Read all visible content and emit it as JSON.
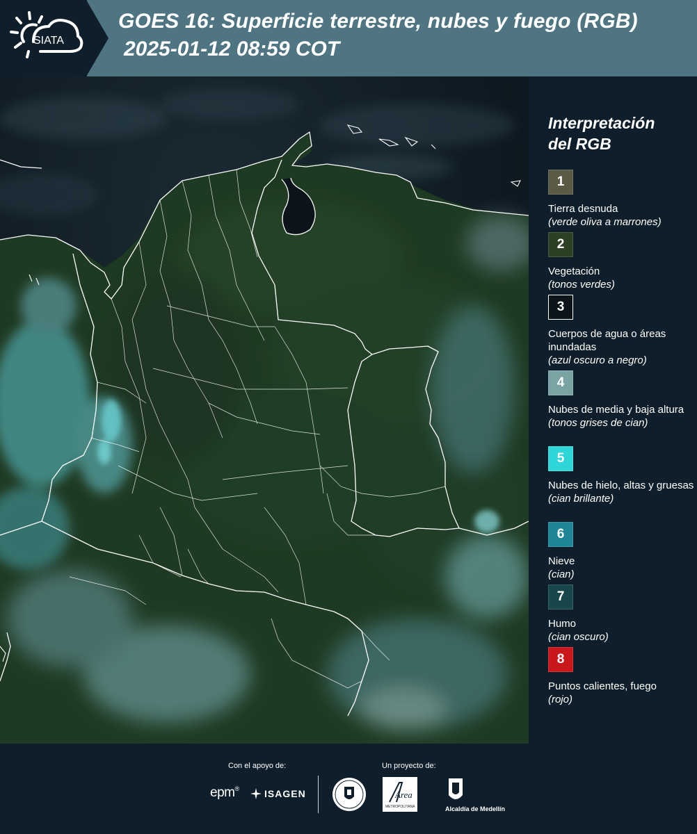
{
  "header": {
    "logo_text": "SIATA",
    "title": "GOES 16: Superficie terrestre, nubes y fuego (RGB)",
    "subtitle": "2025-01-12 08:59 COT"
  },
  "legend": {
    "title_line1": "Interpretación",
    "title_line2": "del RGB",
    "items": [
      {
        "number": "1",
        "label": "Tierra desnuda",
        "desc": "(verde oliva a marrones)",
        "color": "#5b5a45"
      },
      {
        "number": "2",
        "label": "Vegetación",
        "desc": "(tonos verdes)",
        "color": "#2c4124"
      },
      {
        "number": "3",
        "label": "Cuerpos de agua o áreas inundadas",
        "desc": "(azul oscuro a negro)",
        "color": "#0a1419"
      },
      {
        "number": "4",
        "label": "Nubes de media y baja altura",
        "desc": "(tonos grises de cian)",
        "color": "#7aa4a4"
      },
      {
        "number": "5",
        "label": "Nubes de hielo, altas y gruesas",
        "desc": "(cian brillante)",
        "color": "#2fd6d8"
      },
      {
        "number": "6",
        "label": "Nieve",
        "desc": "(cian)",
        "color": "#1f8697"
      },
      {
        "number": "7",
        "label": "Humo",
        "desc": "(cian oscuro)",
        "color": "#17474b"
      },
      {
        "number": "8",
        "label": "Puntos calientes, fuego",
        "desc": "(rojo)",
        "color": "#c9171c"
      }
    ]
  },
  "footer": {
    "support_label": "Con el apoyo de:",
    "project_label": "Un proyecto de:",
    "epm": "epm",
    "isagen": "ISAGEN",
    "area_name": "Área",
    "area_caption": "METROPOLITANA",
    "alcaldia": "Alcaldía de Medellín"
  },
  "colors": {
    "header_bg": "#4f7583",
    "panel_bg": "#0e1f2b",
    "boundary": "#ffffff"
  }
}
